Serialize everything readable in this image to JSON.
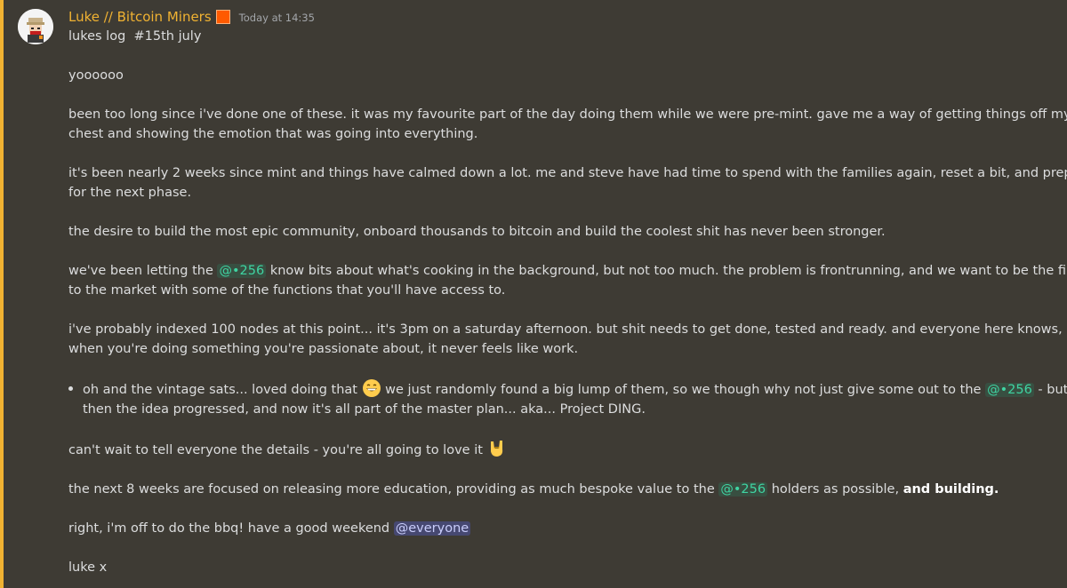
{
  "message": {
    "author": "Luke // Bitcoin Miners",
    "timestamp": "Today at 14:35",
    "accent_color": "#f0b232",
    "badge_color": "#ff5a00",
    "avatar_icon": "bitcoin-miner-avatar",
    "title_line": "lukes log  #15th july",
    "greeting": "yoooooo",
    "p1_l1": "been too long since i've done one of these. it was my favourite part of the day doing them while we were pre-mint. gave me a way of getting things off my",
    "p1_l2": "chest and showing the emotion that was going into everything.",
    "p2_l1": "it's been nearly 2 weeks since mint and things have calmed down a lot. me and steve have had time to spend with the families again, reset a bit, and prepare",
    "p2_l2": "for the next phase.",
    "p3": "the desire to build the most epic community, onboard thousands to bitcoin and build the coolest shit has never been stronger.",
    "p4_l1_a": "we've been letting the ",
    "role_mention": "@•256",
    "p4_l1_b": " know bits about what's cooking in the background, but not too much. the problem is frontrunning, and we want to be the first",
    "p4_l2": "to the market with some of the functions that you'll have access to.",
    "p5_l1": "i've probably indexed 100 nodes at this point... it's 3pm on a saturday afternoon. but shit needs to get done, tested and ready. and everyone here knows,",
    "p5_l2": "when you're doing something you're passionate about, it never feels like work.",
    "bullet_l1_a": "oh and the vintage sats... loved doing that ",
    "bullet_l1_b": " we just randomly found a big lump of them, so we though why not just give some out to the ",
    "bullet_l1_c": " - but",
    "bullet_l2": "then the idea progressed, and now it's all part of the master plan... aka... Project DING.",
    "p6": "can't wait to tell everyone the details - you're all going to love it ",
    "p7_a": "the next 8 weeks are focused on releasing more education, providing as much bespoke value to the ",
    "p7_b": " holders as possible, ",
    "p7_bold": "and building.",
    "p8_a": "right, i'm off to do the bbq! have a good weekend ",
    "everyone_mention": "@everyone",
    "signoff": "luke x",
    "emoji_grin": "grinning-face-icon",
    "emoji_rock": "sign-of-horns-icon"
  }
}
